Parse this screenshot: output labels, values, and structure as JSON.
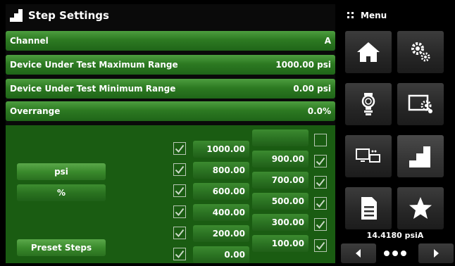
{
  "header": {
    "title": "Step Settings"
  },
  "settings": [
    {
      "label": "Channel",
      "value": "A"
    },
    {
      "label": "Device Under Test Maximum Range",
      "value": "1000.00 psi"
    },
    {
      "label": "Device Under Test Minimum Range",
      "value": "0.00 psi"
    },
    {
      "label": "Overrange",
      "value": "0.0%"
    }
  ],
  "units": {
    "primary": "psi",
    "secondary": "%"
  },
  "preset_label": "Preset Steps",
  "steps_left": [
    "1000.00",
    "800.00",
    "600.00",
    "400.00",
    "200.00",
    "0.00"
  ],
  "steps_right": [
    "900.00",
    "700.00",
    "500.00",
    "300.00",
    "100.00"
  ],
  "checks_left": [
    true,
    true,
    true,
    true,
    true,
    true
  ],
  "checks_right": [
    false,
    true,
    true,
    true,
    true,
    true
  ],
  "menu": {
    "label": "Menu"
  },
  "status": {
    "pressure": "14.4180 psiA"
  },
  "colors": {
    "accent_green": "#2d7a22",
    "panel_green": "#1a5c12",
    "tile_gray": "#2c2c2c"
  }
}
